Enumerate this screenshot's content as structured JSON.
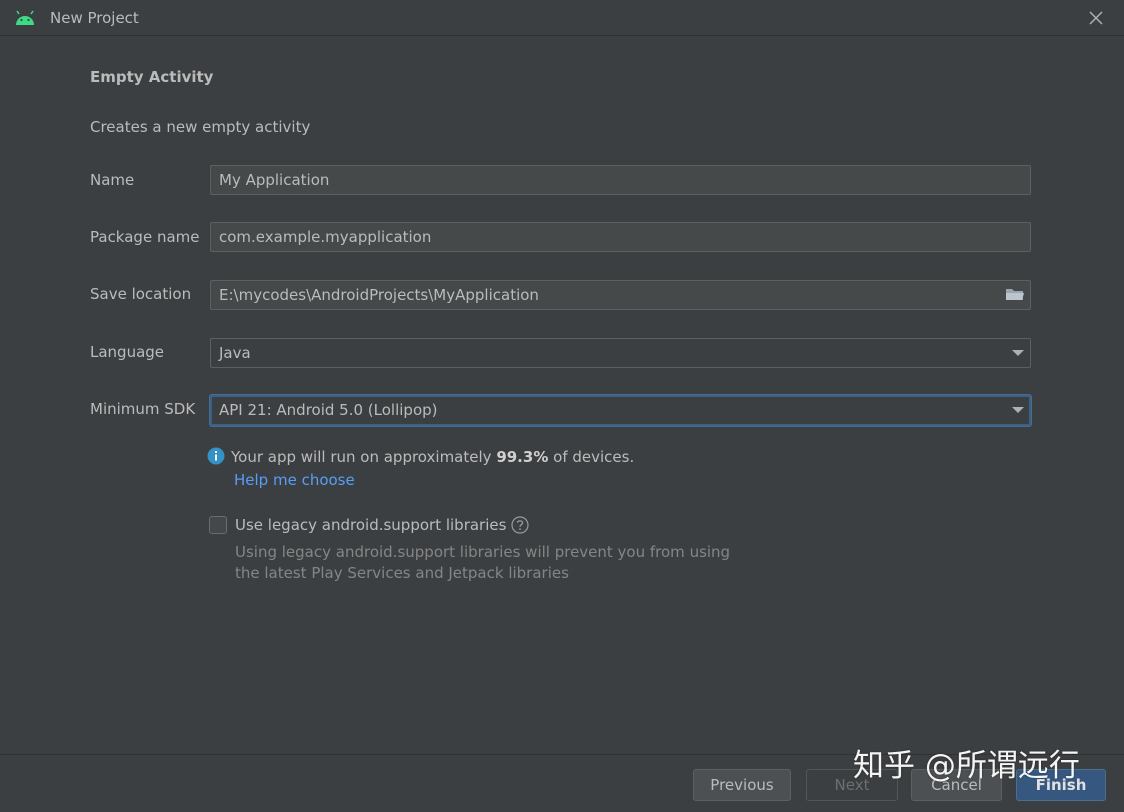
{
  "window": {
    "title": "New Project",
    "icon": "android-icon"
  },
  "heading": "Empty Activity",
  "subtitle": "Creates a new empty activity",
  "form": {
    "name": {
      "label": "Name",
      "value": "My Application"
    },
    "package": {
      "label": "Package name",
      "value": "com.example.myapplication"
    },
    "location": {
      "label": "Save location",
      "value": "E:\\mycodes\\AndroidProjects\\MyApplication",
      "icon": "folder-icon"
    },
    "language": {
      "label": "Language",
      "value": "Java"
    },
    "min_sdk": {
      "label": "Minimum SDK",
      "value": "API 21: Android 5.0 (Lollipop)"
    }
  },
  "info": {
    "prefix": "Your app will run on approximately",
    "percent": "99.3%",
    "suffix": "of devices.",
    "help_link": "Help me choose"
  },
  "legacy": {
    "checkbox_label": "Use legacy android.support libraries",
    "checked": false,
    "desc_line1": "Using legacy android.support libraries will prevent you from using",
    "desc_line2": "the latest Play Services and Jetpack libraries"
  },
  "footer": {
    "previous": "Previous",
    "next": "Next",
    "cancel": "Cancel",
    "finish": "Finish"
  },
  "watermark": "知乎 @所谓远行",
  "colors": {
    "accent": "#589df6",
    "primary_button": "#365880",
    "android_green": "#3ddc84"
  }
}
